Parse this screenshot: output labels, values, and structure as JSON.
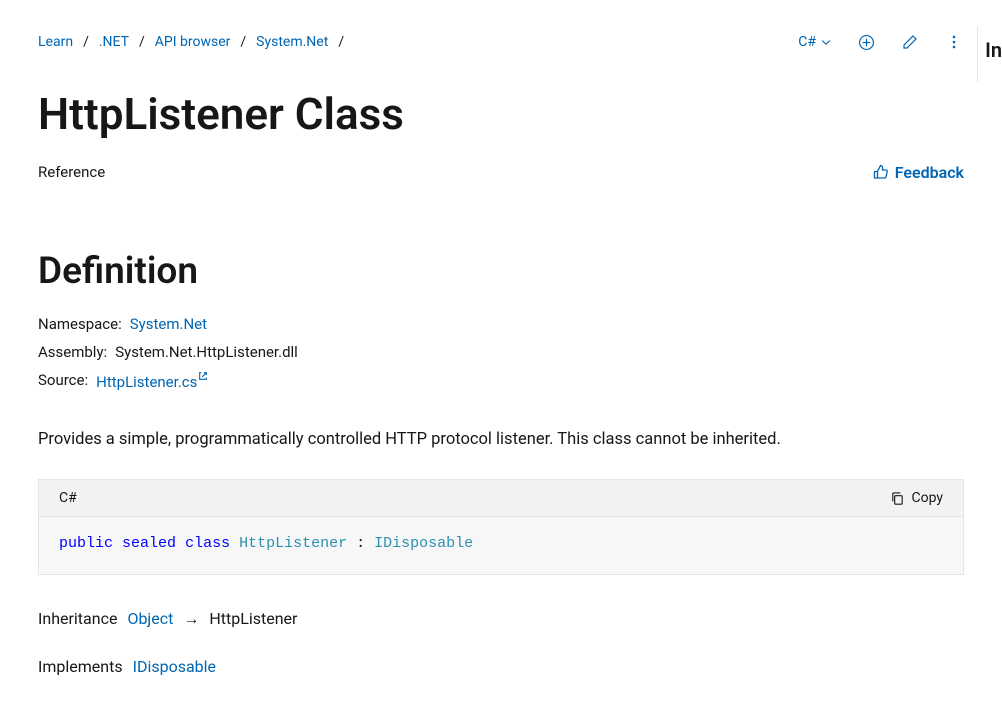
{
  "breadcrumb": {
    "items": [
      "Learn",
      ".NET",
      "API browser",
      "System.Net"
    ],
    "sep": "/"
  },
  "actions": {
    "language": "C#",
    "add_label": "Add",
    "edit_label": "Edit",
    "more_label": "More"
  },
  "title": "HttpListener Class",
  "reference_label": "Reference",
  "feedback_label": "Feedback",
  "section_definition": "Definition",
  "meta": {
    "namespace_label": "Namespace:",
    "namespace_value": "System.Net",
    "assembly_label": "Assembly:",
    "assembly_value": "System.Net.HttpListener.dll",
    "source_label": "Source:",
    "source_value": "HttpListener.cs"
  },
  "description": "Provides a simple, programmatically controlled HTTP protocol listener. This class cannot be inherited.",
  "code": {
    "lang": "C#",
    "copy_label": "Copy",
    "tokens": {
      "kw_public": "public",
      "kw_sealed": "sealed",
      "kw_class": "class",
      "type_name": "HttpListener",
      "colon": " : ",
      "iface": "IDisposable"
    }
  },
  "inheritance": {
    "label": "Inheritance",
    "base": "Object",
    "arrow": "→",
    "self": "HttpListener"
  },
  "implements": {
    "label": "Implements",
    "iface": "IDisposable"
  },
  "right_cut": "In"
}
